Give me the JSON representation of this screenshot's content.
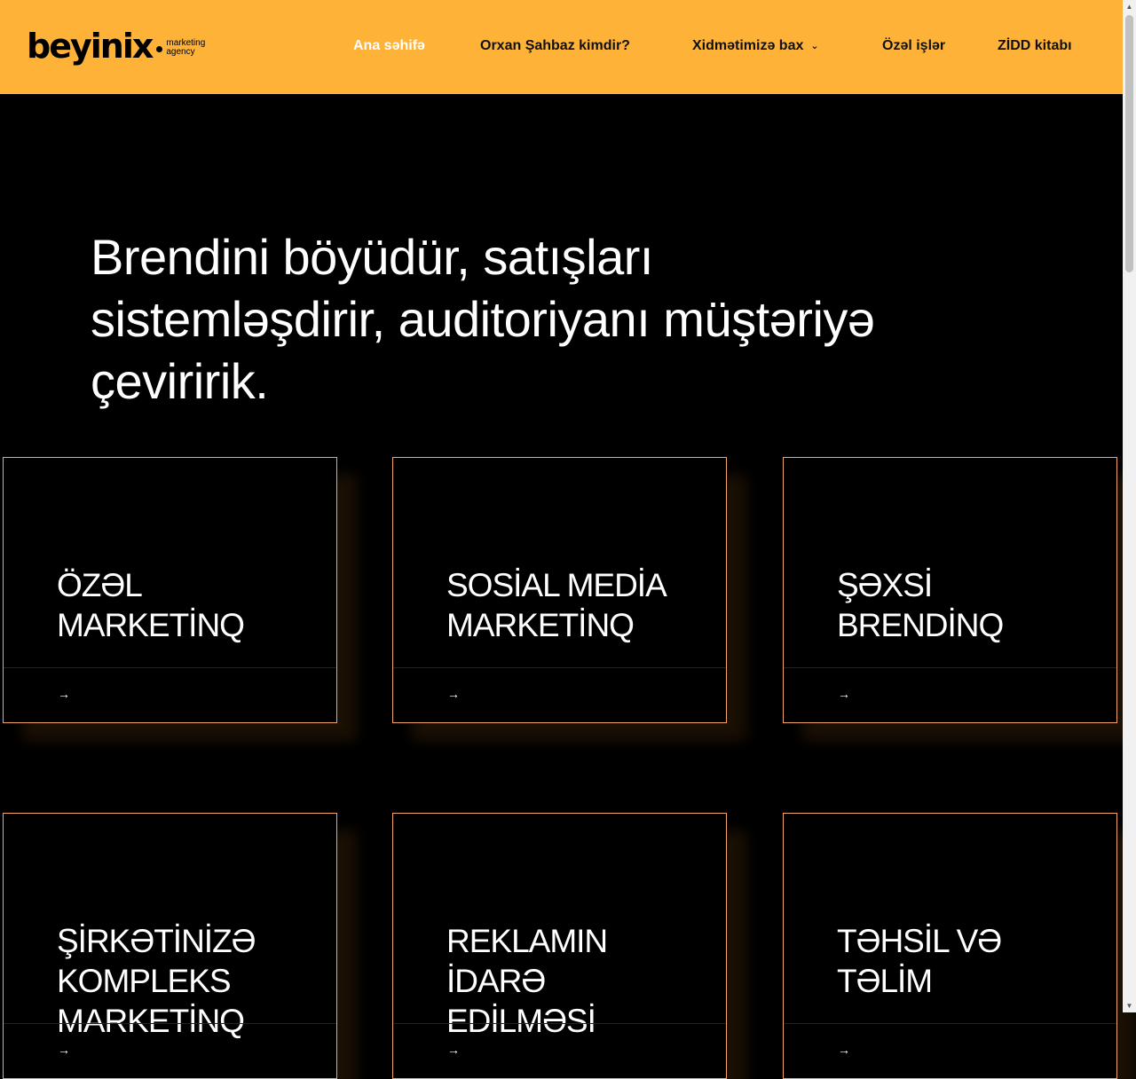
{
  "header": {
    "logo": {
      "word": "beyinix",
      "tag_line1": "marketing",
      "tag_line2": "agency"
    },
    "nav": [
      {
        "label": "Ana səhifə",
        "active": true
      },
      {
        "label": "Orxan Şahbaz kimdir?"
      },
      {
        "label": "Xidmətimizə bax",
        "dropdown": true
      },
      {
        "label": "Özəl işlər"
      },
      {
        "label": "ZİDD kitabı"
      }
    ],
    "colors": {
      "background": "#ffb238",
      "active_text": "#ffffff"
    }
  },
  "hero": {
    "line1": "Brendini böyüdür, satışları",
    "line2": "sistemləşdirir, auditoriyanı müştəriyə",
    "line3": "çeviririk."
  },
  "services": [
    {
      "line1": "ÖZƏL",
      "line2": "MARKETİNQ",
      "line3": "",
      "arrow": "→"
    },
    {
      "line1": "SOSİAL MEDİA",
      "line2": "MARKETİNQ",
      "line3": "",
      "arrow": "→"
    },
    {
      "line1": "ŞƏXSİ",
      "line2": "BRENDİNQ",
      "line3": "",
      "arrow": "→"
    },
    {
      "line1": "ŞİRKƏTİNİZƏ",
      "line2": "KOMPLEKS",
      "line3": "MARKETİNQ",
      "arrow": "→"
    },
    {
      "line1": "REKLAMIN",
      "line2": "İDARƏ",
      "line3": "EDİLMƏSİ",
      "arrow": "→"
    },
    {
      "line1": "TƏHSİL VƏ",
      "line2": "TƏLİM",
      "line3": "",
      "arrow": "→"
    }
  ]
}
